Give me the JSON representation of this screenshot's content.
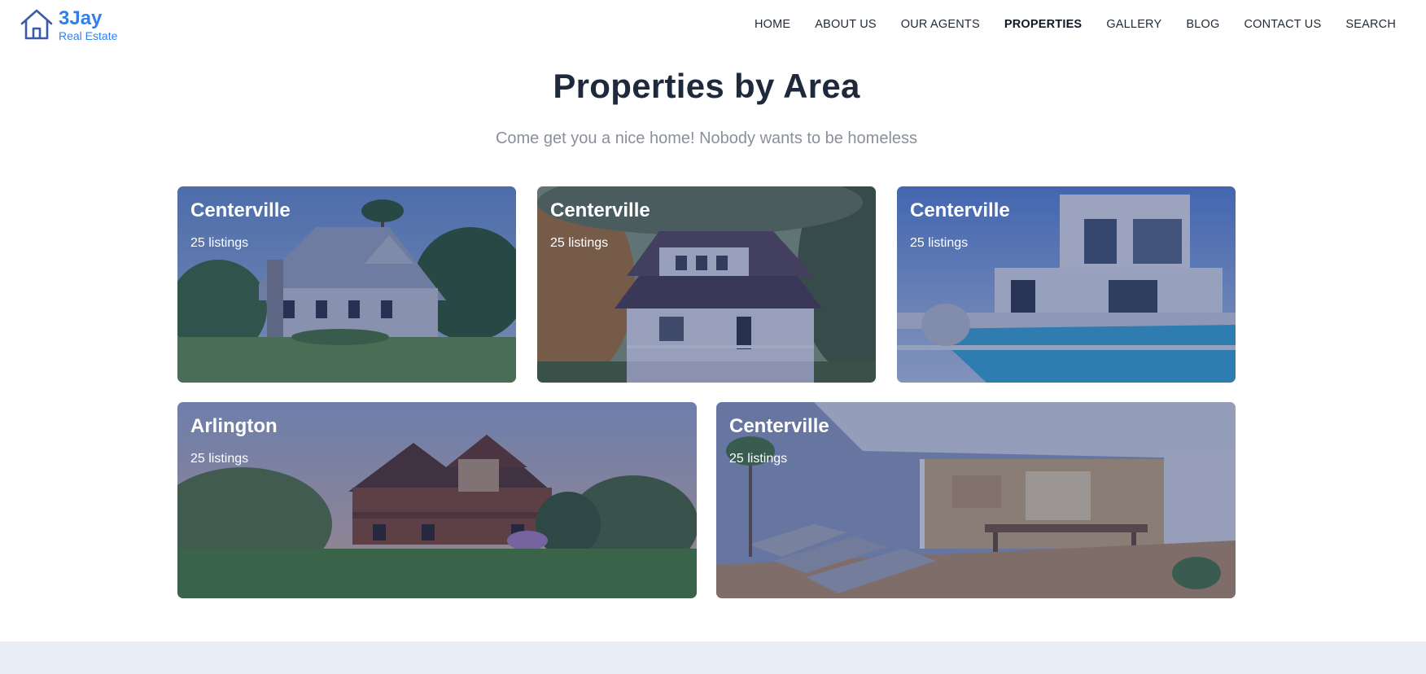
{
  "brand": {
    "name": "3Jay",
    "tagline": "Real Estate",
    "color": "#2f80ed",
    "icon": "house-icon"
  },
  "nav": {
    "items": [
      {
        "label": "HOME",
        "active": false
      },
      {
        "label": "ABOUT US",
        "active": false
      },
      {
        "label": "OUR AGENTS",
        "active": false
      },
      {
        "label": "PROPERTIES",
        "active": true
      },
      {
        "label": "GALLERY",
        "active": false
      },
      {
        "label": "BLOG",
        "active": false
      },
      {
        "label": "CONTACT US",
        "active": false
      },
      {
        "label": "SEARCH",
        "active": false
      }
    ]
  },
  "section": {
    "title": "Properties by Area",
    "subtitle": "Come get you a nice home! Nobody wants to be homeless"
  },
  "areas": [
    {
      "name": "Centerville",
      "listings": "25 listings",
      "image": "craftsman-house-photo"
    },
    {
      "name": "Centerville",
      "listings": "25 listings",
      "image": "white-porch-house-photo"
    },
    {
      "name": "Centerville",
      "listings": "25 listings",
      "image": "modern-pool-villa-photo"
    },
    {
      "name": "Arlington",
      "listings": "25 listings",
      "image": "log-lake-house-photo"
    },
    {
      "name": "Centerville",
      "listings": "25 listings",
      "image": "patio-deck-interior-photo"
    }
  ]
}
